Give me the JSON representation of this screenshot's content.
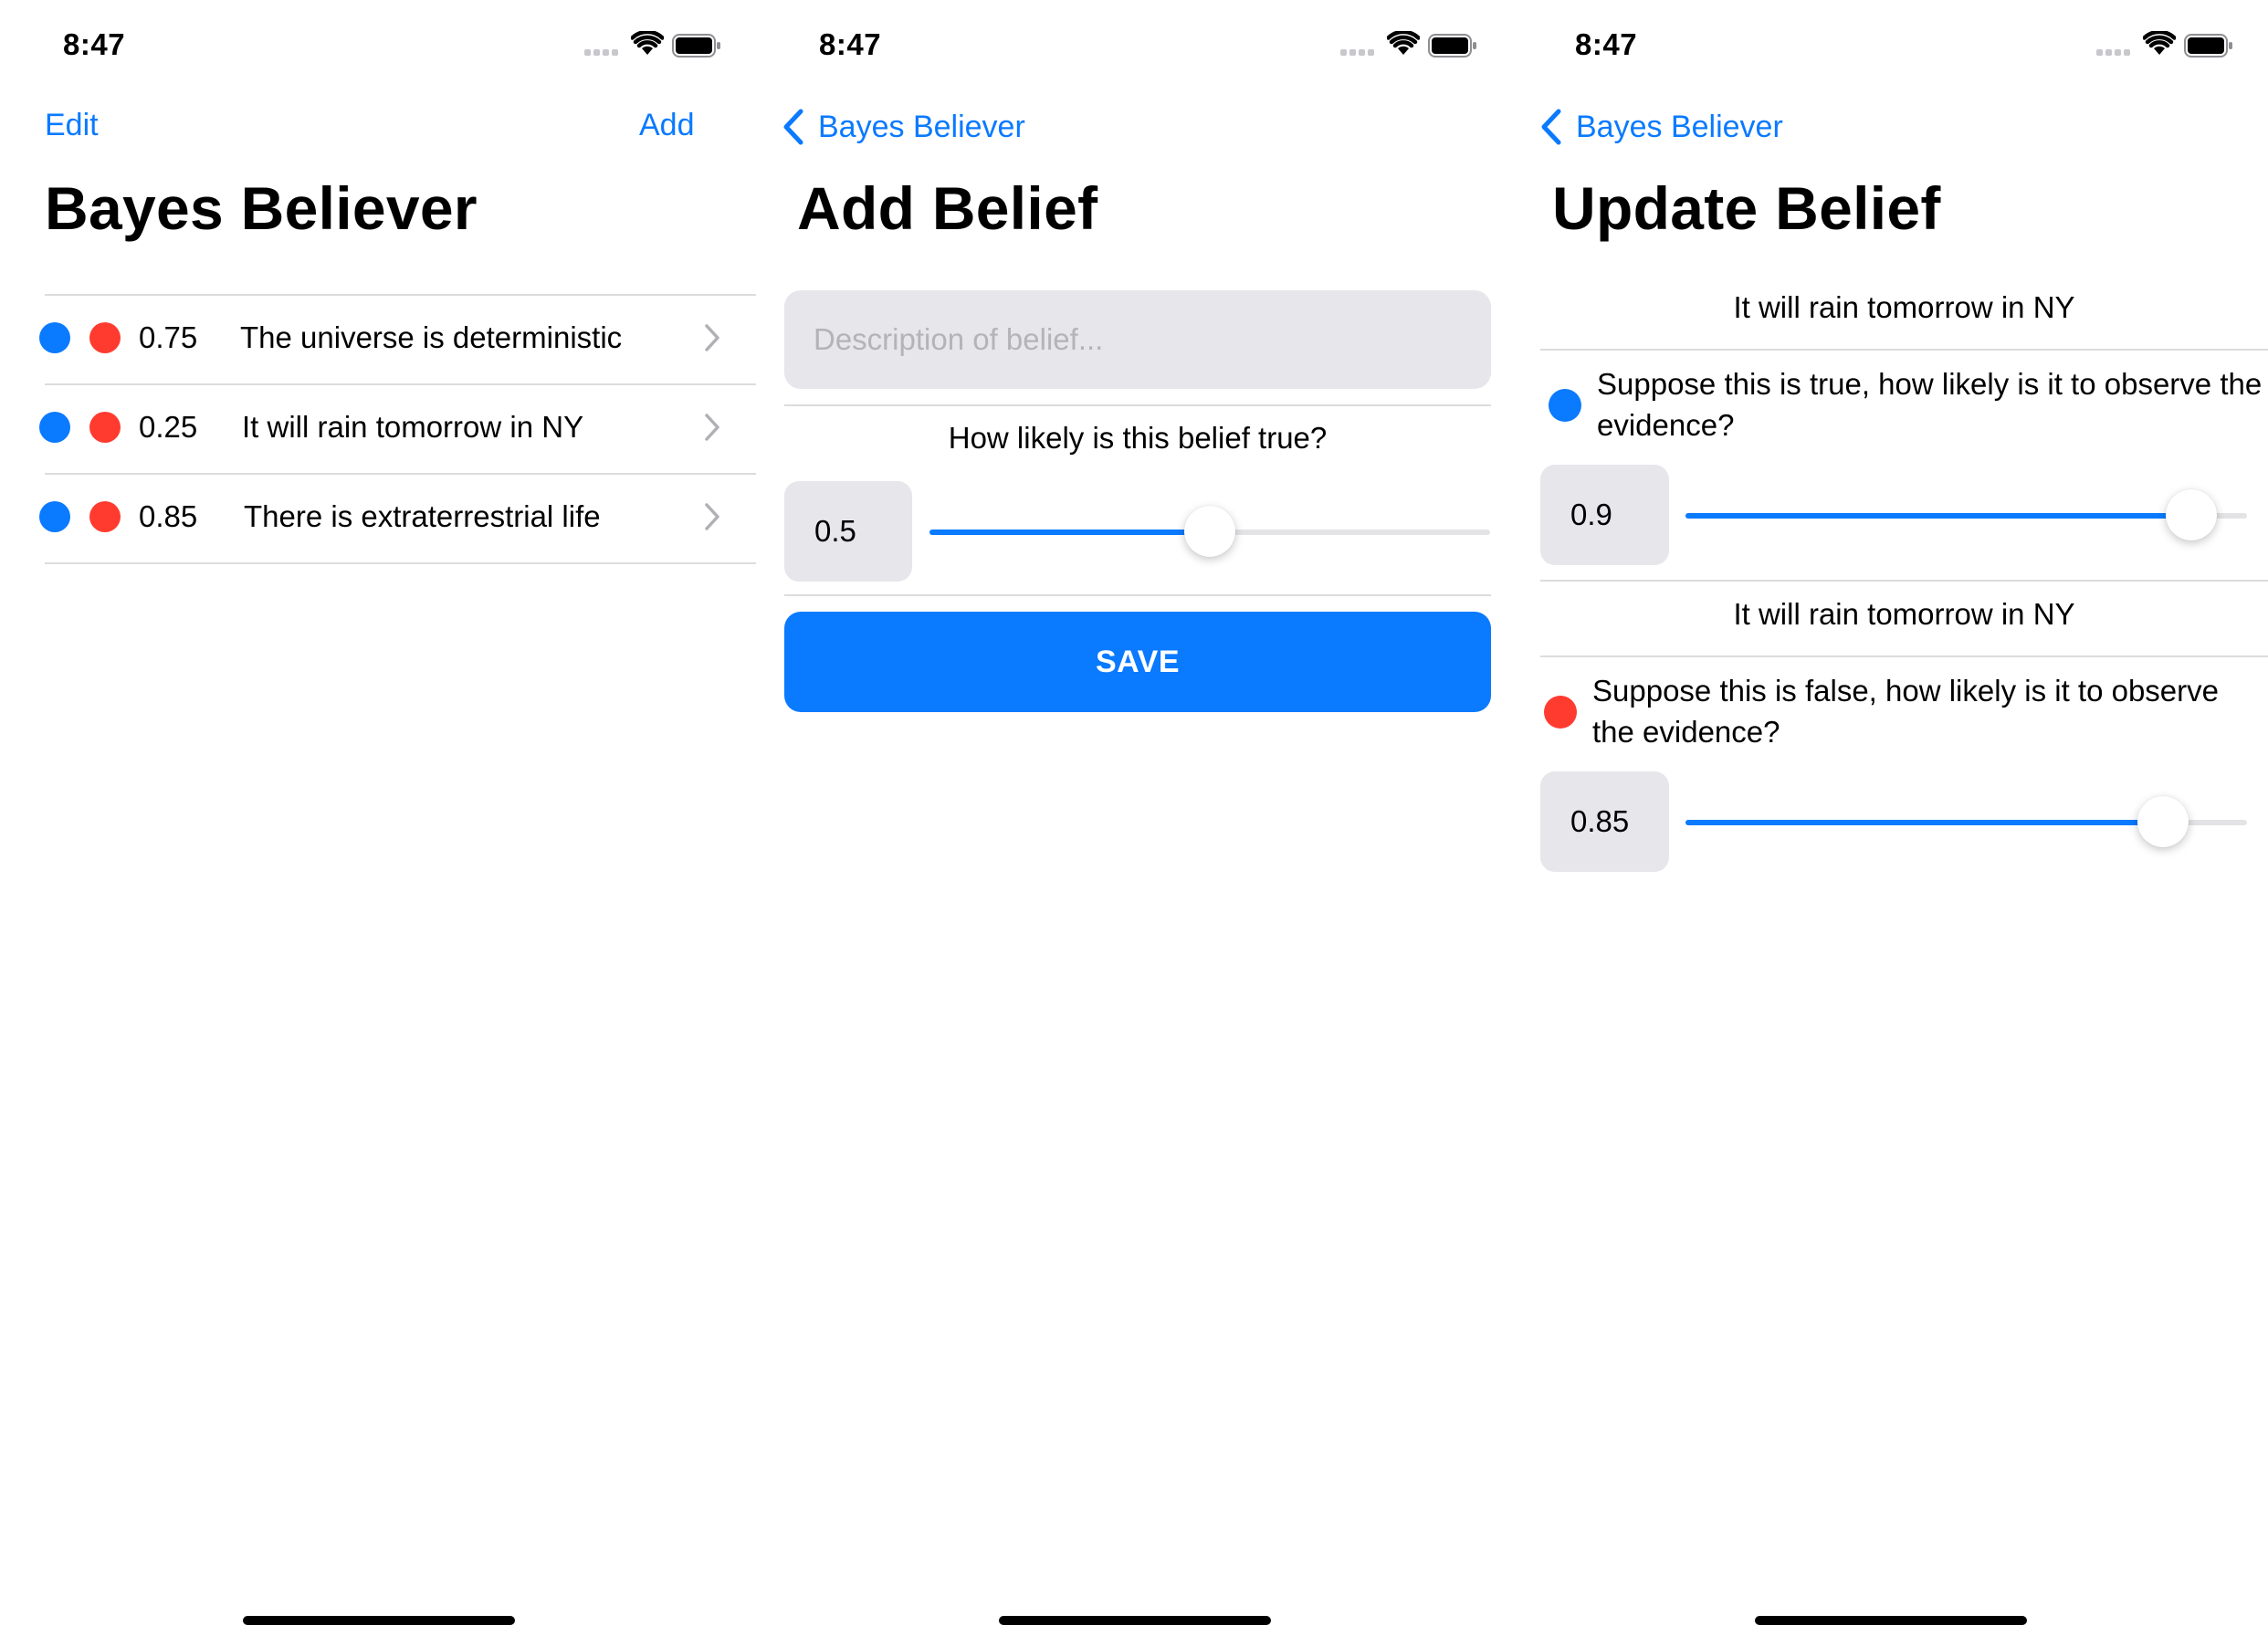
{
  "colors": {
    "accent": "#0a7aff",
    "true_dot": "#0a7aff",
    "false_dot": "#ff3b30",
    "field_background": "#e6e6eb"
  },
  "status_bar": {
    "time": "8:47"
  },
  "screens": {
    "list": {
      "nav_left": "Edit",
      "nav_right": "Add",
      "title": "Bayes Believer",
      "beliefs": [
        {
          "probability": "0.75",
          "text": "The universe is deterministic"
        },
        {
          "probability": "0.25",
          "text": "It will rain tomorrow in NY"
        },
        {
          "probability": "0.85",
          "text": "There is extraterrestrial life"
        }
      ]
    },
    "add": {
      "back_label": "Bayes Believer",
      "title": "Add Belief",
      "description_value": "",
      "description_placeholder": "Description of belief...",
      "question": "How likely is this belief true?",
      "value": "0.5",
      "slider_fraction": 0.5,
      "save_label": "SAVE"
    },
    "update": {
      "back_label": "Bayes Believer",
      "title": "Update Belief",
      "belief_text_1": "It will rain tomorrow in NY",
      "question_true": "Suppose this is true, how likely is it to observe the evidence?",
      "value_true": "0.9",
      "slider_true_fraction": 0.9,
      "belief_text_2": "It will rain tomorrow in NY",
      "question_false": "Suppose this is false, how likely is it to observe the evidence?",
      "value_false": "0.85",
      "slider_false_fraction": 0.85
    }
  }
}
